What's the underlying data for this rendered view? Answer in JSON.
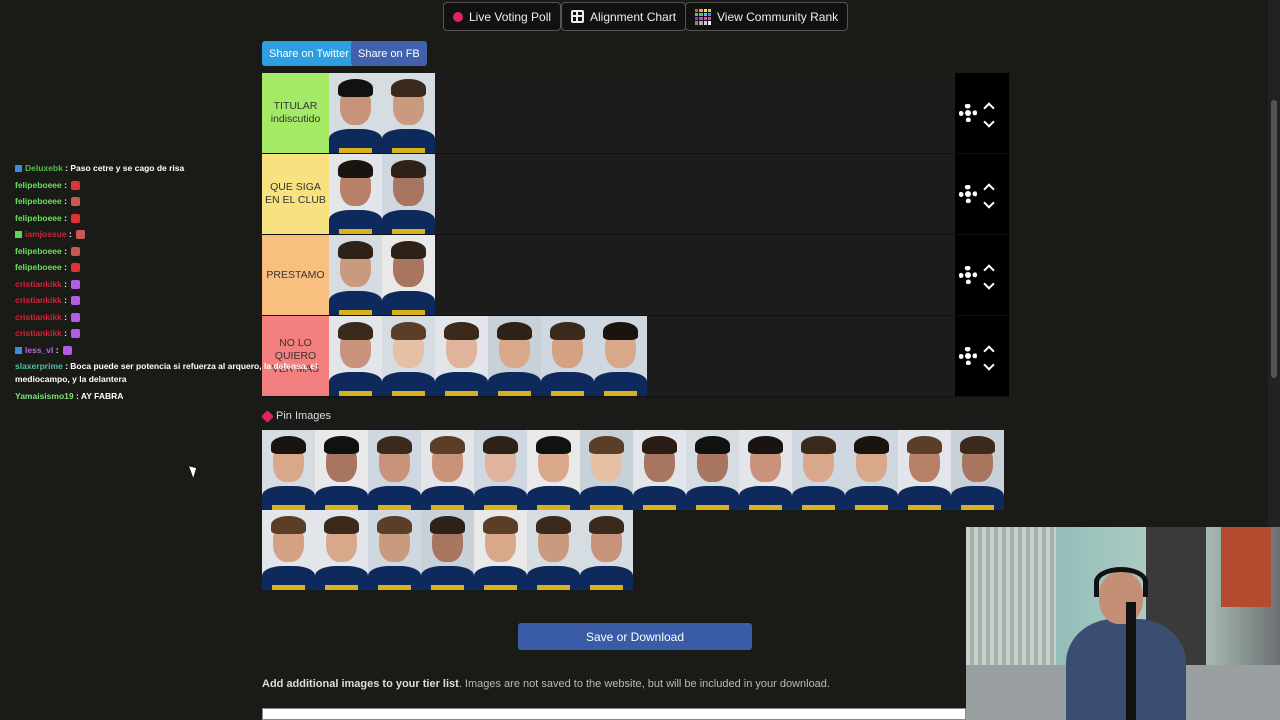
{
  "top_buttons": {
    "live_voting": "Live Voting Poll",
    "alignment_chart": "Alignment Chart",
    "community_rank": "View Community Rank"
  },
  "share": {
    "twitter": "Share on Twitter",
    "fb": "Share on FB"
  },
  "tiers": [
    {
      "label": "TITULAR indiscutido",
      "color": "#a4ea66",
      "images": 2
    },
    {
      "label": "QUE SIGA EN EL CLUB",
      "color": "#f7e27f",
      "images": 2
    },
    {
      "label": "PRESTAMO",
      "color": "#f9bf7e",
      "images": 2
    },
    {
      "label": "NO LO QUIERO VER MAS",
      "color": "#f47f7f",
      "images": 6
    }
  ],
  "pin_images_label": "Pin Images",
  "pool_image_count": 21,
  "save_label": "Save or Download",
  "add_images": {
    "bold": "Add additional images to your tier list",
    "rest": ". Images are not saved to the website, but will be included in your download."
  },
  "chat": [
    {
      "user": "Deluxebk",
      "color": "#4ec04e",
      "text": "Paso cetre y se cago de risa",
      "badge": "#3a8dde"
    },
    {
      "user": "felipeboeee",
      "color": "#6be05e",
      "text": "",
      "emote": "#d33"
    },
    {
      "user": "felipeboeee",
      "color": "#6be05e",
      "text": "",
      "emote": "#c55"
    },
    {
      "user": "felipeboeee",
      "color": "#6be05e",
      "text": "",
      "emote": "#d33"
    },
    {
      "user": "iamjossue",
      "color": "#d0243c",
      "text": "",
      "emote": "#c55",
      "badge": "#5ad55a"
    },
    {
      "user": "felipeboeee",
      "color": "#6be05e",
      "text": "",
      "emote": "#c55"
    },
    {
      "user": "felipeboeee",
      "color": "#6be05e",
      "text": "",
      "emote": "#d33"
    },
    {
      "user": "cristiankikk",
      "color": "#d0243c",
      "text": "",
      "emote": "#b35ee0"
    },
    {
      "user": "cristiankikk",
      "color": "#d0243c",
      "text": "",
      "emote": "#b35ee0"
    },
    {
      "user": "cristiankikk",
      "color": "#d0243c",
      "text": "",
      "emote": "#b35ee0"
    },
    {
      "user": "cristiankikk",
      "color": "#d0243c",
      "text": "",
      "emote": "#b35ee0"
    },
    {
      "user": "less_vl",
      "color": "#b36be0",
      "text": "",
      "emote": "#b35ee0",
      "badge": "#3a8dde"
    },
    {
      "user": "slaxerprime",
      "color": "#4ec0a0",
      "text": "Boca puede ser potencia si refuerza al arquero, la defensa, el mediocampo, y la delantera",
      "wrap": true
    },
    {
      "user": "Yamaisismo19",
      "color": "#7ee07e",
      "text": "AY FABRA"
    }
  ],
  "colors": {
    "save_button": "#3a5ba5",
    "twitter": "#2d9fe0",
    "fb": "#4161ad",
    "tier_controls": "#000000"
  }
}
